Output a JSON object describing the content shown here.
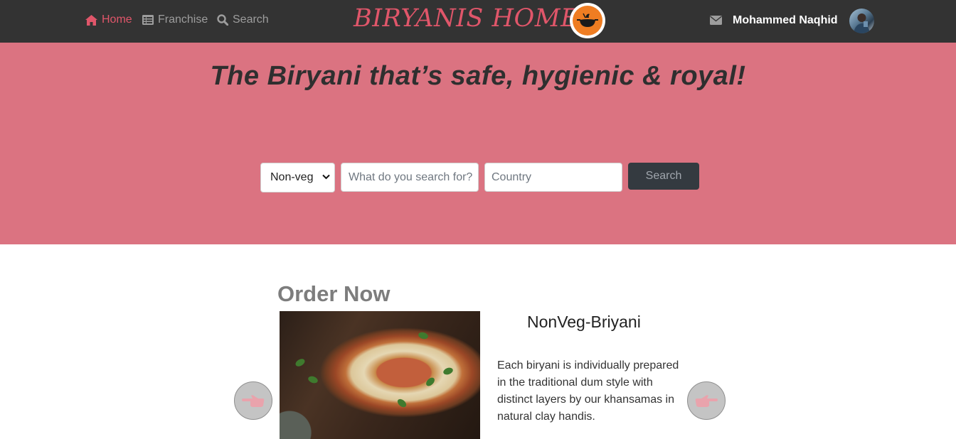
{
  "nav": {
    "home_label": "Home",
    "franchise_label": "Franchise",
    "search_label": "Search",
    "brand": "BIRYANIS HOME",
    "username": "Mohammed Naqhid"
  },
  "hero": {
    "tagline": "The Biryani that’s safe, hygienic & royal!",
    "category_selected": "Non-veg",
    "search_placeholder": "What do you search for?",
    "country_placeholder": "Country",
    "search_button": "Search"
  },
  "order": {
    "title": "Order Now",
    "dish_name": "NonVeg-Briyani",
    "dish_description": "Each biryani is individually prepared in the traditional dum style with distinct layers by our khansamas in natural clay handis."
  },
  "icons": {
    "home": "home-icon",
    "franchise": "list-icon",
    "search": "search-icon",
    "logo": "cooking-pot-logo",
    "mail": "envelope-icon",
    "prev": "hand-pointing-left-icon",
    "next": "hand-pointing-right-icon"
  },
  "colors": {
    "navbar": "#333333",
    "accent": "#e0566a",
    "hero": "#db7381",
    "button": "#343a40"
  }
}
